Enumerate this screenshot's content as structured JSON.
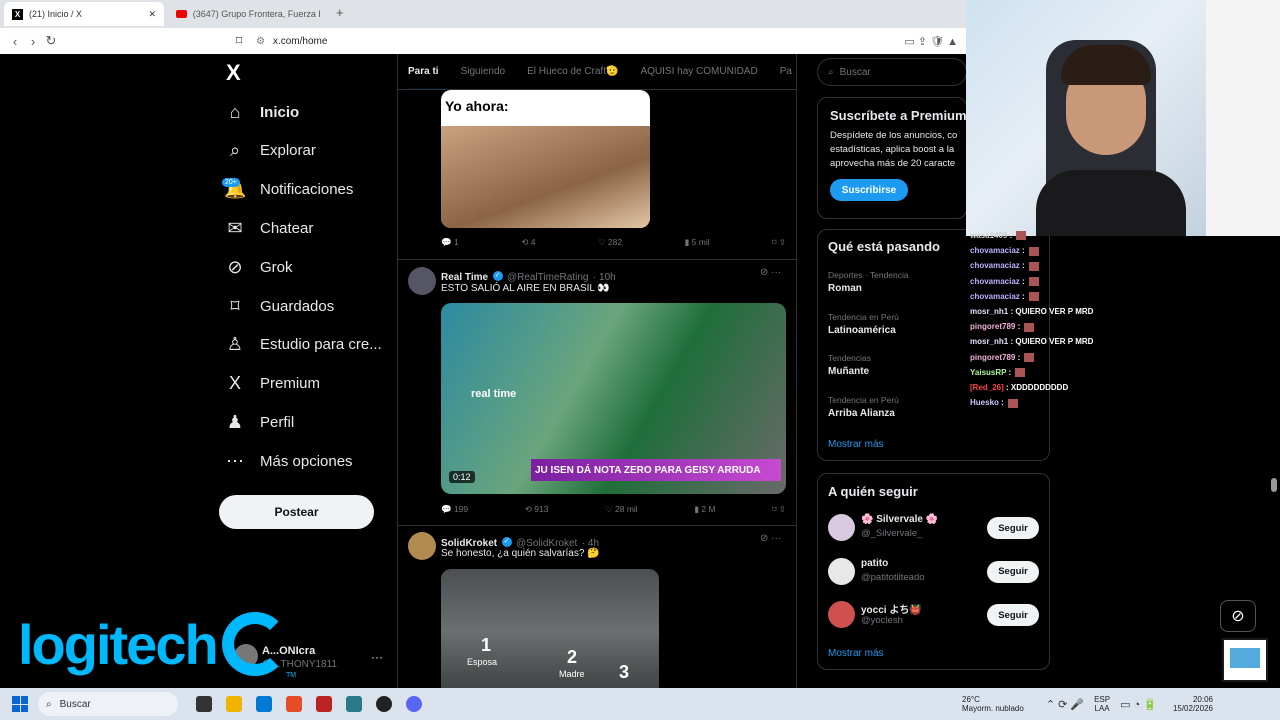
{
  "browser": {
    "tabs": [
      {
        "title": "(21) Inicio / X"
      },
      {
        "title": "(3647) Grupo Frontera, Fuerza Regid..."
      }
    ],
    "new_tab": "+",
    "close": "✕",
    "url": "x.com/home"
  },
  "sidebar": {
    "logo": "X",
    "badge": "20+",
    "items": [
      {
        "label": "Inicio",
        "icon": "home-icon"
      },
      {
        "label": "Explorar",
        "icon": "search-icon"
      },
      {
        "label": "Notificaciones",
        "icon": "bell-icon"
      },
      {
        "label": "Chatear",
        "icon": "mail-icon"
      },
      {
        "label": "Grok",
        "icon": "grok-icon"
      },
      {
        "label": "Guardados",
        "icon": "bookmark-icon"
      },
      {
        "label": "Estudio para cre...",
        "icon": "creator-icon"
      },
      {
        "label": "Premium",
        "icon": "premium-icon"
      },
      {
        "label": "Perfil",
        "icon": "person-icon"
      },
      {
        "label": "Más opciones",
        "icon": "more-icon"
      }
    ],
    "post_button": "Postear",
    "account": {
      "name": "A...ONIcra",
      "handle": "@...THONY1811"
    }
  },
  "feed": {
    "tabs": [
      "Para ti",
      "Siguiendo",
      "El Hueco de Craft🫡",
      "AQUISI hay COMUNIDAD",
      "Pa"
    ],
    "meme_text": "Yo ahora:",
    "tweet0_actions": {
      "replies": "1",
      "reposts": "4",
      "likes": "282",
      "views": "5 mil"
    },
    "tweets": [
      {
        "name": "Real Time",
        "handle": "@RealTimeRating",
        "time": "· 10h",
        "text": "ESTO SALIÓ AL AIRE EN BRASIL 👀",
        "video_brand": "real time",
        "video_caption": "JU ISEN DÁ NOTA ZERO PARA GEISY ARRUDA",
        "video_time": "0:12",
        "replies": "199",
        "reposts": "913",
        "likes": "28 mil",
        "views": "2 M"
      },
      {
        "name": "SolidKroket",
        "handle": "@SolidKroket",
        "time": "· 4h",
        "text": "Se honesto, ¿a quién salvarías? 🤔",
        "img_labels": [
          "1",
          "Esposa",
          "2",
          "Madre",
          "3"
        ]
      }
    ]
  },
  "right": {
    "search_placeholder": "Buscar",
    "premium": {
      "title": "Suscríbete a Premium",
      "body": "Despídete de los anuncios, co estadísticas, aplica boost a la aprovecha más de 20 caracte",
      "button": "Suscribirse"
    },
    "trends_title": "Qué está pasando",
    "trends": [
      {
        "meta": "Deportes · Tendencia",
        "name": "Roman"
      },
      {
        "meta": "Tendencia en Perú",
        "name": "Latinoamérica"
      },
      {
        "meta": "Tendencias",
        "name": "Muñante"
      },
      {
        "meta": "Tendencia en Perú",
        "name": "Arriba Alianza"
      }
    ],
    "show_more": "Mostrar más",
    "follow_title": "A quién seguir",
    "follow": [
      {
        "name": "🌸 Silvervale 🌸",
        "handle": "@_Silvervale_"
      },
      {
        "name": "patito",
        "handle": "@patitotilteado"
      },
      {
        "name": "yocci よち👹",
        "handle": "@yoclesh"
      }
    ],
    "follow_button": "Seguir",
    "show_more2": "Mostrar más"
  },
  "chat": [
    {
      "user": "wasa1409",
      "msg": ""
    },
    {
      "user": "chovamaciaz",
      "msg": ""
    },
    {
      "user": "chovamaciaz",
      "msg": ""
    },
    {
      "user": "chovamaciaz",
      "msg": ""
    },
    {
      "user": "chovamaciaz",
      "msg": ""
    },
    {
      "user": "mosr_nh1",
      "msg": "QUIERO VER P MRD"
    },
    {
      "user": "pingoret789",
      "msg": ""
    },
    {
      "user": "mosr_nh1",
      "msg": "QUIERO VER P MRD"
    },
    {
      "user": "pingoret789",
      "msg": ""
    },
    {
      "user": "YaisusRP",
      "msg": ""
    },
    {
      "user": "[Red_26]",
      "msg": "XDDDDDDDDD"
    },
    {
      "user": "Huesko",
      "msg": ""
    }
  ],
  "overlay": {
    "logitech": "logitech",
    "tm": "TM"
  },
  "taskbar": {
    "search": "Buscar",
    "weather_temp": "26°C",
    "weather_desc": "Mayorm. nublado",
    "lang1": "ESP",
    "lang2": "LAA",
    "time": "20:06",
    "date": "15/02/2026"
  },
  "colors": {
    "accent": "#1d9bf0",
    "bg": "#000000",
    "postbtn": "#eff3f4",
    "logitech": "#00b8fc"
  }
}
